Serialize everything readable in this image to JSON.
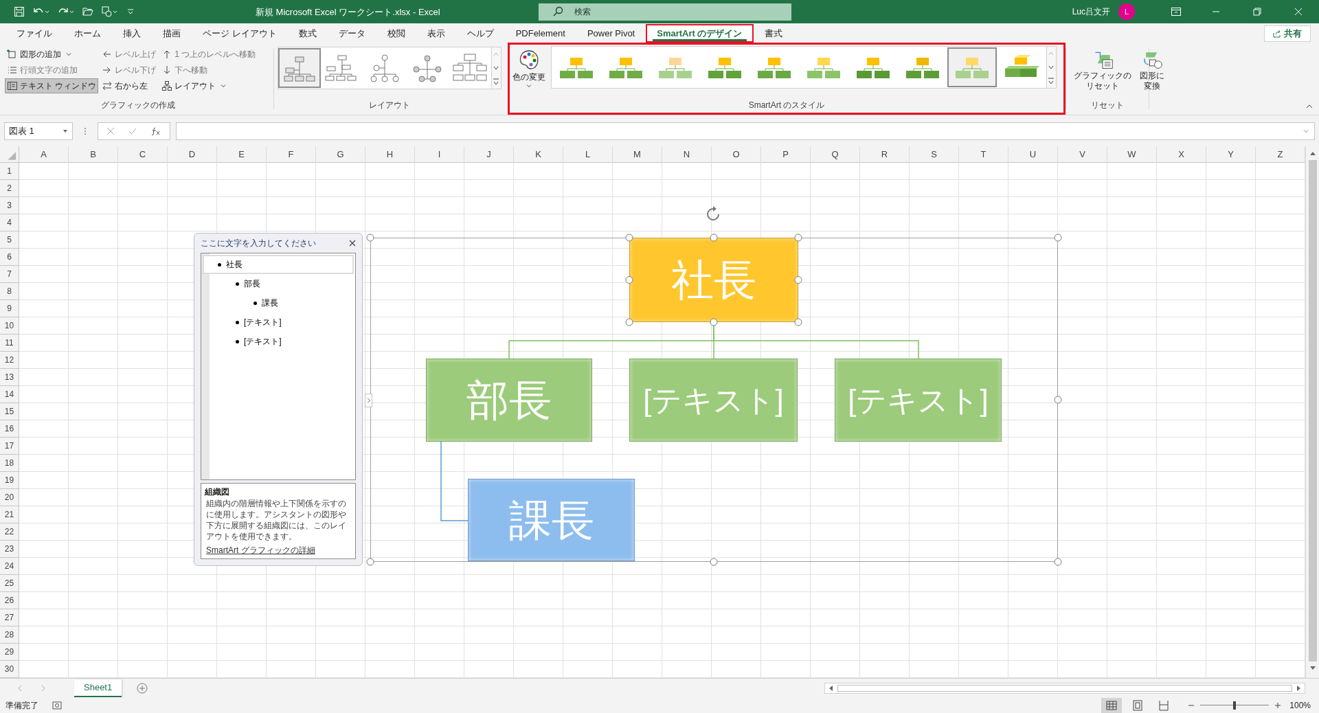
{
  "title_bar": {
    "file_name": "新規 Microsoft Excel ワークシート.xlsx  -  Excel",
    "search": {
      "placeholder": "検索"
    },
    "user": {
      "name": "Luc吕文开",
      "initial": "L"
    }
  },
  "tabs": [
    {
      "label": "ファイル",
      "selected": false,
      "highlighted": false
    },
    {
      "label": "ホーム",
      "selected": false,
      "highlighted": false
    },
    {
      "label": "挿入",
      "selected": false,
      "highlighted": false
    },
    {
      "label": "描画",
      "selected": false,
      "highlighted": false
    },
    {
      "label": "ページ レイアウト",
      "selected": false,
      "highlighted": false
    },
    {
      "label": "数式",
      "selected": false,
      "highlighted": false
    },
    {
      "label": "データ",
      "selected": false,
      "highlighted": false
    },
    {
      "label": "校閲",
      "selected": false,
      "highlighted": false
    },
    {
      "label": "表示",
      "selected": false,
      "highlighted": false
    },
    {
      "label": "ヘルプ",
      "selected": false,
      "highlighted": false
    },
    {
      "label": "PDFelement",
      "selected": false,
      "highlighted": false
    },
    {
      "label": "Power Pivot",
      "selected": false,
      "highlighted": false
    },
    {
      "label": "SmartArt のデザイン",
      "selected": true,
      "highlighted": true
    },
    {
      "label": "書式",
      "selected": false,
      "highlighted": false
    }
  ],
  "share_button": "共有",
  "ribbon": {
    "create_graphic": {
      "label": "グラフィックの作成",
      "highlighted": false,
      "buttons": [
        {
          "label": "図形の追加",
          "disabled": false,
          "on": false,
          "dropdown": true
        },
        {
          "label": "レベル上げ",
          "disabled": true,
          "on": false,
          "dropdown": false
        },
        {
          "label": "1 つ上のレベルへ移動",
          "disabled": true,
          "on": false,
          "dropdown": false
        },
        {
          "label": "行頭文字の追加",
          "disabled": true,
          "on": false,
          "dropdown": false
        },
        {
          "label": "レベル下げ",
          "disabled": true,
          "on": false,
          "dropdown": false
        },
        {
          "label": "下へ移動",
          "disabled": true,
          "on": false,
          "dropdown": false
        },
        {
          "label": "テキスト ウィンドウ",
          "disabled": false,
          "on": true,
          "dropdown": false
        },
        {
          "label": "右から左",
          "disabled": false,
          "on": false,
          "dropdown": false
        },
        {
          "label": "レイアウト",
          "disabled": false,
          "on": false,
          "dropdown": true
        }
      ]
    },
    "layout": {
      "label": "レイアウト",
      "highlighted": false,
      "gallery": [
        {
          "selected": true
        },
        {
          "selected": false
        },
        {
          "selected": false
        },
        {
          "selected": false
        },
        {
          "selected": false
        }
      ]
    },
    "styles": {
      "label": "SmartArt のスタイル",
      "highlighted": true,
      "change_colors": "色の変更",
      "gallery": [
        {
          "selected": false
        },
        {
          "selected": false
        },
        {
          "selected": false
        },
        {
          "selected": false
        },
        {
          "selected": false
        },
        {
          "selected": false
        },
        {
          "selected": false
        },
        {
          "selected": false
        },
        {
          "selected": true
        },
        {
          "selected": false
        }
      ]
    },
    "reset": {
      "label": "リセット",
      "highlighted": false,
      "buttons": [
        {
          "lines": [
            "グラフィックの",
            "リセット"
          ]
        },
        {
          "lines": [
            "図形に",
            "変換"
          ]
        }
      ]
    }
  },
  "formula_bar": {
    "name_box": "図表 1"
  },
  "sheet": {
    "columns": [
      "A",
      "B",
      "C",
      "D",
      "E",
      "F",
      "G",
      "H",
      "I",
      "J",
      "K",
      "L",
      "M",
      "N",
      "O",
      "P",
      "Q",
      "R",
      "S",
      "T",
      "U",
      "V",
      "W",
      "X",
      "Y",
      "Z"
    ],
    "rows": [
      "1",
      "2",
      "3",
      "4",
      "5",
      "6",
      "7",
      "8",
      "9",
      "10",
      "11",
      "12",
      "13",
      "14",
      "15",
      "16",
      "17",
      "18",
      "19",
      "20",
      "21",
      "22",
      "23",
      "24",
      "25",
      "26",
      "27",
      "28",
      "29",
      "30"
    ]
  },
  "smartart": {
    "nodes": [
      {
        "text": "社長",
        "color": "#ffc62e",
        "selected": true
      },
      {
        "text": "部長",
        "color": "#9ccb7b",
        "selected": false
      },
      {
        "text": "[テキスト]",
        "color": "#9ccb7b",
        "selected": false
      },
      {
        "text": "[テキスト]",
        "color": "#9ccb7b",
        "selected": false
      },
      {
        "text": "課長",
        "color": "#8dbdee",
        "selected": false
      }
    ]
  },
  "text_pane": {
    "title": "ここに文字を入力してください",
    "items": [
      {
        "text": "社長",
        "selected": true,
        "children": [
          {
            "text": "部長",
            "selected": false,
            "children": [
              {
                "text": "課長",
                "selected": false
              }
            ]
          },
          {
            "text": "[テキスト]",
            "selected": false
          },
          {
            "text": "[テキスト]",
            "selected": false
          }
        ]
      }
    ],
    "description": {
      "title": "組織図",
      "body": "組織内の階層情報や上下関係を示すのに使用します。アシスタントの図形や下方に展開する組織図には、このレイアウトを使用できます。",
      "link": "SmartArt グラフィックの詳細"
    }
  },
  "sheet_tabs": [
    {
      "label": "Sheet1",
      "selected": true
    }
  ],
  "status_bar": {
    "status": "準備完了",
    "views": [
      {
        "selected": true
      },
      {
        "selected": false
      },
      {
        "selected": false
      }
    ],
    "zoom": {
      "level": 0.5,
      "reading": "100%"
    }
  }
}
